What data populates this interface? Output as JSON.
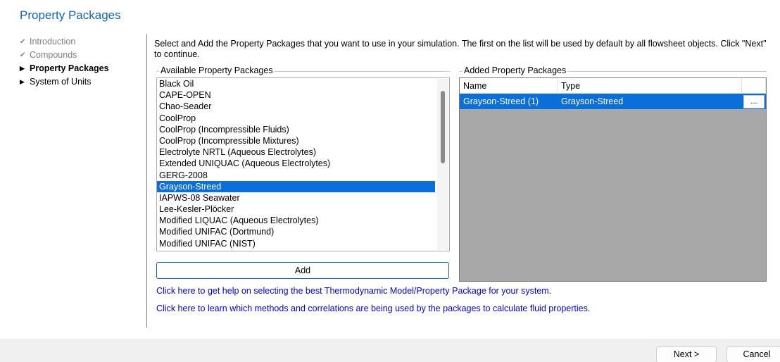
{
  "page": {
    "title": "Property Packages",
    "instructions": "Select and Add the Property Packages that you want to use in your simulation. The first on the list will be used by default by all flowsheet objects. Click \"Next\" to continue."
  },
  "nav": {
    "items": [
      {
        "label": "Introduction",
        "state": "completed",
        "icon": "checkmark-icon"
      },
      {
        "label": "Compounds",
        "state": "completed",
        "icon": "checkmark-icon"
      },
      {
        "label": "Property Packages",
        "state": "current",
        "icon": "triangle-right-icon"
      },
      {
        "label": "System of Units",
        "state": "pending",
        "icon": "triangle-right-icon"
      }
    ]
  },
  "available": {
    "label": "Available Property Packages",
    "items": [
      "Black Oil",
      "CAPE-OPEN",
      "Chao-Seader",
      "CoolProp",
      "CoolProp (Incompressible Fluids)",
      "CoolProp (Incompressible Mixtures)",
      "Electrolyte NRTL (Aqueous Electrolytes)",
      "Extended UNIQUAC (Aqueous Electrolytes)",
      "GERG-2008",
      "Grayson-Streed",
      "IAPWS-08 Seawater",
      "Lee-Kesler-Plöcker",
      "Modified LIQUAC (Aqueous Electrolytes)",
      "Modified UNIFAC (Dortmund)",
      "Modified UNIFAC (NIST)"
    ],
    "selected": "Grayson-Streed",
    "add_label": "Add"
  },
  "added": {
    "label": "Added Property Packages",
    "columns": [
      "Name",
      "Type"
    ],
    "rows": [
      {
        "name": "Grayson-Streed (1)",
        "type": "Grayson-Streed",
        "button": "..."
      }
    ]
  },
  "links": {
    "help_model": "Click here to get help on selecting the best Thermodynamic Model/Property Package for your system.",
    "methods": "Click here to learn which methods and correlations are being used by the packages to calculate fluid properties."
  },
  "footer": {
    "next_label": "Next >",
    "cancel_label": "Cancel"
  },
  "colors": {
    "accent": "#1565b8",
    "selection": "#0a6fd8",
    "link": "#0000e6",
    "grid_background": "#a8a8a8"
  }
}
